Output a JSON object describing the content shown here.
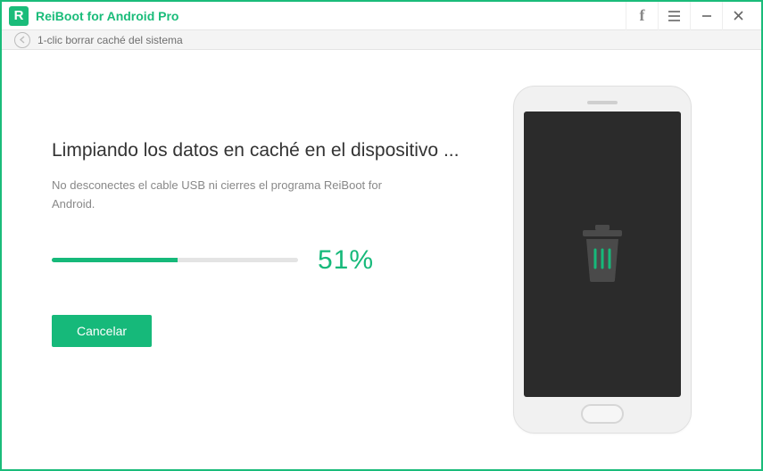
{
  "window": {
    "app_title": "ReiBoot for Android Pro",
    "logo_letter": "R"
  },
  "breadcrumb": {
    "label": "1-clic borrar caché del sistema"
  },
  "main": {
    "heading": "Limpiando los datos en caché en el dispositivo ...",
    "subtext": "No desconectes el cable USB ni cierres el programa ReiBoot for Android.",
    "progress_percent": 51,
    "progress_label": "51%",
    "cancel_label": "Cancelar"
  },
  "colors": {
    "accent": "#16b97a"
  }
}
